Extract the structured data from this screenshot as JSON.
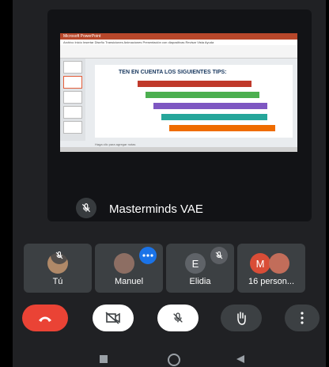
{
  "main_tile": {
    "presenter_name": "Masterminds VAE",
    "shared_screen": {
      "window_title": "Microsoft PowerPoint",
      "ribbon_tabs": "Archivo  Inicio  Insertar  Diseño  Transiciones  Animaciones  Presentación con diapositivas  Revisar  Vista  Ayuda",
      "slide_title": "TEN EN CUENTA LOS SIGUIENTES TIPS:",
      "notes_placeholder": "Haga clic para agregar notas"
    }
  },
  "participants": [
    {
      "name": "Tú"
    },
    {
      "name": "Manuel"
    },
    {
      "name": "Elidia",
      "initial": "E"
    },
    {
      "name": "16 person...",
      "initial": "M"
    }
  ],
  "colors": {
    "background": "#202124",
    "tile": "#3c4043",
    "end_call": "#ea4335",
    "control_white": "#ffffff",
    "control_dark": "#3c4043",
    "accent_blue": "#1a73e8",
    "avatar_m": "#d94d37",
    "avatar_e": "#5f6368"
  },
  "controls": [
    {
      "icon": "end-call-icon"
    },
    {
      "icon": "camera-off-icon"
    },
    {
      "icon": "mic-off-icon"
    },
    {
      "icon": "raise-hand-icon"
    },
    {
      "icon": "more-options-icon"
    }
  ],
  "nav": [
    "back-icon",
    "home-icon",
    "recents-icon"
  ]
}
